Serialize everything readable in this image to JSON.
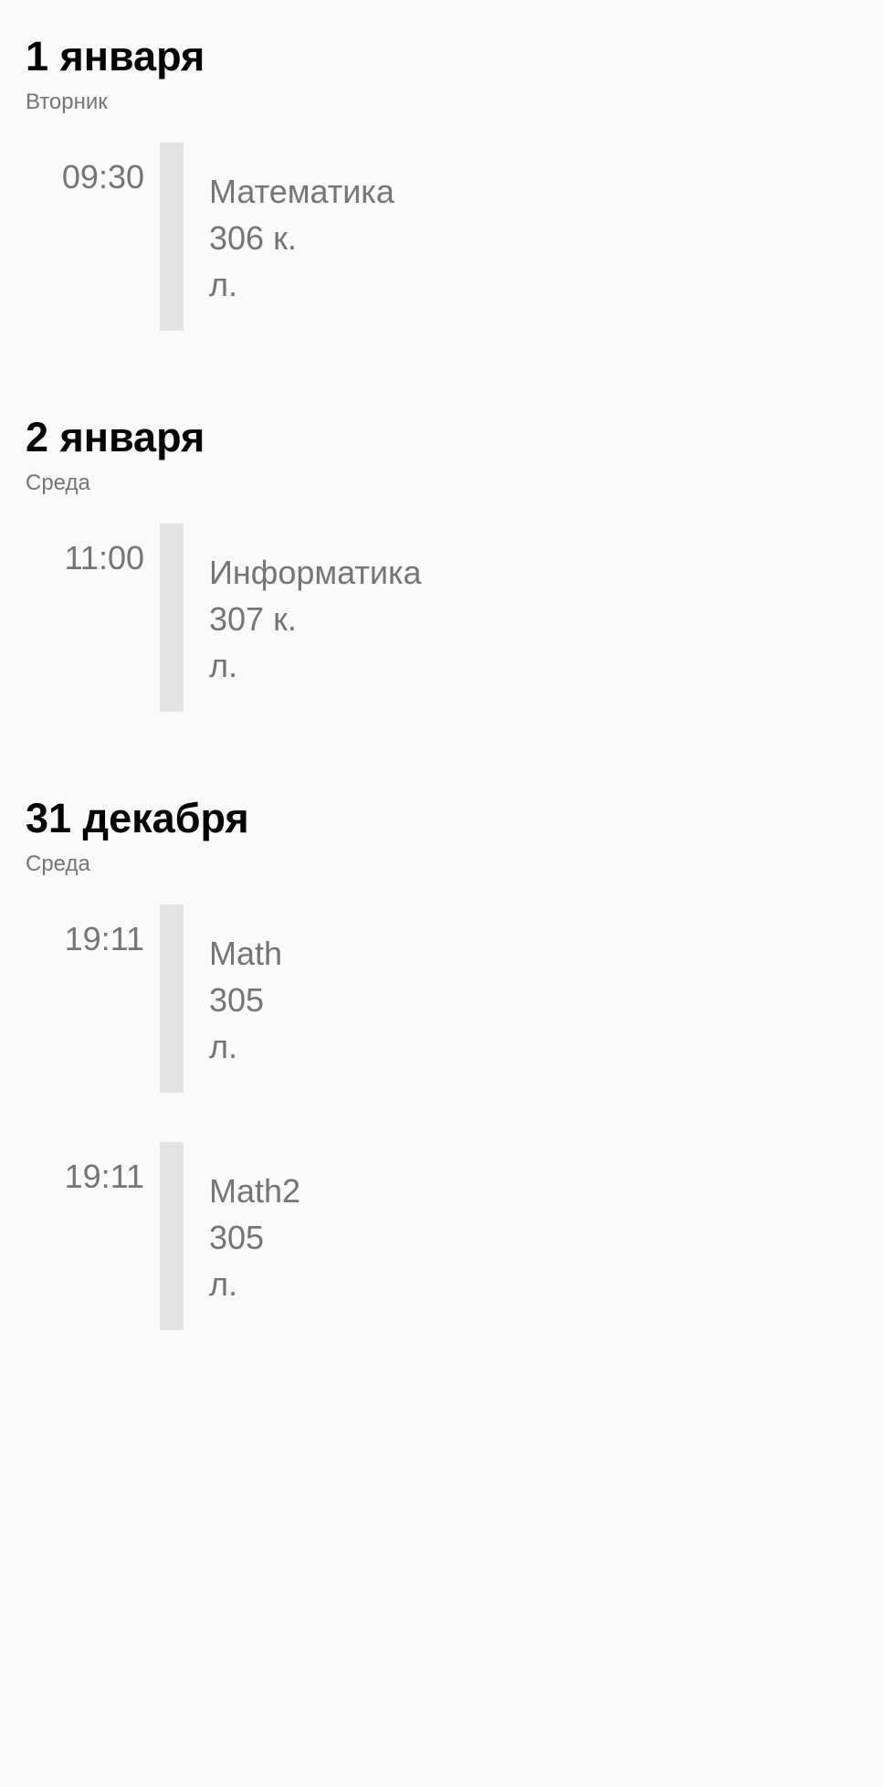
{
  "colors": {
    "background": "#fafafa",
    "text_secondary": "#757575",
    "bar": "#e3e3e3",
    "heading": "#000000"
  },
  "sections": [
    {
      "date": "1 января",
      "weekday": "Вторник",
      "events": [
        {
          "time": "09:30",
          "subject": "Математика",
          "room": "306 к.",
          "type": "л."
        }
      ]
    },
    {
      "date": "2 января",
      "weekday": "Среда",
      "events": [
        {
          "time": "11:00",
          "subject": "Информатика",
          "room": "307 к.",
          "type": "л."
        }
      ]
    },
    {
      "date": "31 декабря",
      "weekday": "Среда",
      "events": [
        {
          "time": "19:11",
          "subject": "Math",
          "room": "305",
          "type": "л."
        },
        {
          "time": "19:11",
          "subject": "Math2",
          "room": "305",
          "type": "л."
        }
      ]
    }
  ]
}
